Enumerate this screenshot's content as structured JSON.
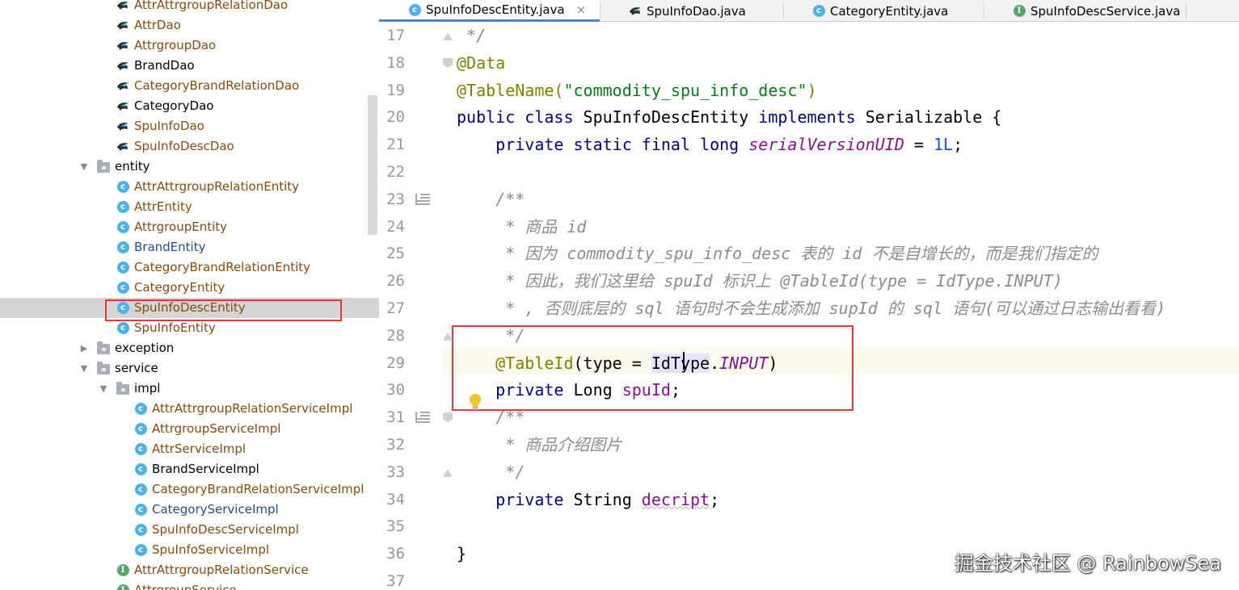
{
  "tree": {
    "items": [
      {
        "label": "AttrAttrgroupRelationDao",
        "kind": "bird",
        "color": "#8a4a0a",
        "depth": 2
      },
      {
        "label": "AttrDao",
        "kind": "bird",
        "color": "#8a4a0a",
        "depth": 2
      },
      {
        "label": "AttrgroupDao",
        "kind": "bird",
        "color": "#8a4a0a",
        "depth": 2
      },
      {
        "label": "BrandDao",
        "kind": "bird",
        "color": "#000000",
        "depth": 2
      },
      {
        "label": "CategoryBrandRelationDao",
        "kind": "bird",
        "color": "#8a4a0a",
        "depth": 2
      },
      {
        "label": "CategoryDao",
        "kind": "bird",
        "color": "#000000",
        "depth": 2
      },
      {
        "label": "SpuInfoDao",
        "kind": "bird",
        "color": "#8a4a0a",
        "depth": 2
      },
      {
        "label": "SpuInfoDescDao",
        "kind": "bird",
        "color": "#8a4a0a",
        "depth": 2
      },
      {
        "label": "entity",
        "kind": "folder",
        "color": "#000000",
        "depth": 1,
        "arrow": "open"
      },
      {
        "label": "AttrAttrgroupRelationEntity",
        "kind": "class",
        "color": "#8a4a0a",
        "depth": 2
      },
      {
        "label": "AttrEntity",
        "kind": "class",
        "color": "#8a4a0a",
        "depth": 2
      },
      {
        "label": "AttrgroupEntity",
        "kind": "class",
        "color": "#8a4a0a",
        "depth": 2
      },
      {
        "label": "BrandEntity",
        "kind": "class",
        "color": "#1f4e9c",
        "depth": 2
      },
      {
        "label": "CategoryBrandRelationEntity",
        "kind": "class",
        "color": "#8a4a0a",
        "depth": 2
      },
      {
        "label": "CategoryEntity",
        "kind": "class",
        "color": "#8a4a0a",
        "depth": 2
      },
      {
        "label": "SpuInfoDescEntity",
        "kind": "class",
        "color": "#8a4a0a",
        "depth": 2,
        "selected": true
      },
      {
        "label": "SpuInfoEntity",
        "kind": "class",
        "color": "#8a4a0a",
        "depth": 2
      },
      {
        "label": "exception",
        "kind": "folder",
        "color": "#000000",
        "depth": 1,
        "arrow": "closed"
      },
      {
        "label": "service",
        "kind": "folder",
        "color": "#000000",
        "depth": 1,
        "arrow": "open"
      },
      {
        "label": "impl",
        "kind": "folder",
        "color": "#000000",
        "depth": 2,
        "arrow": "open"
      },
      {
        "label": "AttrAttrgroupRelationServiceImpl",
        "kind": "class",
        "color": "#8a4a0a",
        "depth": 3
      },
      {
        "label": "AttrgroupServiceImpl",
        "kind": "class",
        "color": "#8a4a0a",
        "depth": 3
      },
      {
        "label": "AttrServiceImpl",
        "kind": "class",
        "color": "#8a4a0a",
        "depth": 3
      },
      {
        "label": "BrandServiceImpl",
        "kind": "class",
        "color": "#000000",
        "depth": 3
      },
      {
        "label": "CategoryBrandRelationServiceImpl",
        "kind": "class",
        "color": "#8a4a0a",
        "depth": 3
      },
      {
        "label": "CategoryServiceImpl",
        "kind": "class",
        "color": "#1f4e9c",
        "depth": 3
      },
      {
        "label": "SpuInfoDescServiceImpl",
        "kind": "class",
        "color": "#8a4a0a",
        "depth": 3
      },
      {
        "label": "SpuInfoServiceImpl",
        "kind": "class",
        "color": "#8a4a0a",
        "depth": 3
      },
      {
        "label": "AttrAttrgroupRelationService",
        "kind": "interface",
        "color": "#8a4a0a",
        "depth": 2
      },
      {
        "label": "AttrgroupService",
        "kind": "interface",
        "color": "#8a4a0a",
        "depth": 2
      }
    ]
  },
  "tabs": [
    {
      "label": "SpuInfoDescEntity.java",
      "icon": "class-icon",
      "active": true
    },
    {
      "label": "SpuInfoDao.java",
      "icon": "bird-icon",
      "active": false
    },
    {
      "label": "CategoryEntity.java",
      "icon": "class-icon",
      "active": false
    },
    {
      "label": "SpuInfoDescService.java",
      "icon": "interface-icon",
      "active": false
    }
  ],
  "tab_close_glyph": "×",
  "editor": {
    "line_numbers": [
      "17",
      "18",
      "19",
      "20",
      "21",
      "22",
      "23",
      "24",
      "25",
      "26",
      "27",
      "28",
      "29",
      "30",
      "31",
      "32",
      "33",
      "34",
      "35",
      "36",
      "37"
    ],
    "lines": [
      [
        {
          "t": " */",
          "c": "cmt"
        }
      ],
      [
        {
          "t": "@Data",
          "c": "ann"
        }
      ],
      [
        {
          "t": "@TableName(",
          "c": "ann"
        },
        {
          "t": "\"commodity_spu_info_desc\"",
          "c": "str"
        },
        {
          "t": ")",
          "c": "ann"
        }
      ],
      [
        {
          "t": "public class ",
          "c": "kw"
        },
        {
          "t": "SpuInfoDescEntity ",
          "c": ""
        },
        {
          "t": "implements ",
          "c": "kw"
        },
        {
          "t": "Serializable {",
          "c": ""
        }
      ],
      [
        {
          "t": "    private static final long ",
          "c": "kw"
        },
        {
          "t": "serialVersionUID",
          "c": "sfld"
        },
        {
          "t": " = ",
          "c": ""
        },
        {
          "t": "1L",
          "c": "num"
        },
        {
          "t": ";",
          "c": ""
        }
      ],
      [],
      [
        {
          "t": "    /**",
          "c": "cmt"
        }
      ],
      [
        {
          "t": "     * 商品 id",
          "c": "cmt"
        }
      ],
      [
        {
          "t": "     * 因为 commodity_spu_info_desc 表的 id 不是自增长的，而是我们指定的",
          "c": "cmt"
        }
      ],
      [
        {
          "t": "     * 因此，我们这里给 spuId 标识上 @TableId(type = IdType.INPUT)",
          "c": "cmt"
        }
      ],
      [
        {
          "t": "     * , 否则底层的 sql 语句时不会生成添加 supId 的 sql 语句(可以通过日志输出看看)",
          "c": "cmt"
        }
      ],
      [
        {
          "t": "     */",
          "c": "cmt"
        }
      ],
      [
        {
          "t": "    @TableId",
          "c": "ann"
        },
        {
          "t": "(type = ",
          "c": ""
        },
        {
          "t": "IdType",
          "c": "hl"
        },
        {
          "t": ".",
          "c": ""
        },
        {
          "t": "INPUT",
          "c": "sfld"
        },
        {
          "t": ")",
          "c": ""
        }
      ],
      [
        {
          "t": "    private ",
          "c": "kw"
        },
        {
          "t": "Long ",
          "c": ""
        },
        {
          "t": "spuId",
          "c": "fld"
        },
        {
          "t": ";",
          "c": ""
        }
      ],
      [
        {
          "t": "    /**",
          "c": "cmt"
        }
      ],
      [
        {
          "t": "     * 商品介绍图片",
          "c": "cmt"
        }
      ],
      [
        {
          "t": "     */",
          "c": "cmt"
        }
      ],
      [
        {
          "t": "    private ",
          "c": "kw"
        },
        {
          "t": "String ",
          "c": ""
        },
        {
          "t": "decript",
          "c": "fld squig"
        },
        {
          "t": ";",
          "c": ""
        }
      ],
      [],
      [
        {
          "t": "}",
          "c": ""
        }
      ],
      []
    ]
  },
  "watermark": "掘金技术社区 @ RainbowSea",
  "colors": {
    "highlight_box": "#e23a3a",
    "selected_row": "#d5d5d5",
    "active_tab_underline": "#4a88c7"
  }
}
